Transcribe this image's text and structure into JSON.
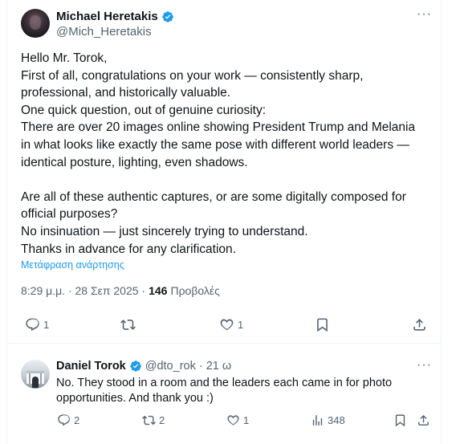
{
  "post": {
    "author_name": "Michael Heretakis",
    "handle": "@Mich_Heretakis",
    "lines": [
      "Hello Mr. Torok,",
      "First of all, congratulations on your work — consistently sharp,",
      "professional, and historically valuable.",
      "One quick question, out of genuine curiosity:",
      "There are over 20 images online showing President Trump and Melania",
      "in what looks like exactly the same pose with different world leaders —",
      "identical posture, lighting, even shadows.",
      "",
      "Are all of these authentic captures, or are some digitally composed for",
      "official purposes?",
      "No insinuation — just sincerely trying to understand.",
      "Thanks in advance for any clarification."
    ],
    "translate_label": "Μετάφραση ανάρτησης",
    "timestamp": "8:29 μ.μ. · 28 Σεπ 2025 ·",
    "views_count": "146",
    "views_label": "Προβολές",
    "replies": "1",
    "reposts": "",
    "likes": "1",
    "more": "···"
  },
  "reply": {
    "author_name": "Daniel Torok",
    "handle": "@dto_rok",
    "time": "21 ω",
    "lines": [
      "No. They stood in a room and the leaders each came in for photo",
      "opportunities. And thank you :)"
    ],
    "replies": "2",
    "reposts": "2",
    "likes": "1",
    "views": "348",
    "more": "···"
  },
  "colors": {
    "text": "#0f1419",
    "secondary": "#536471",
    "accent": "#1d9bf0",
    "border": "#eff3f4"
  },
  "icons": {
    "verified": "verified-badge-icon",
    "reply": "reply-icon",
    "repost": "repost-icon",
    "like": "heart-icon",
    "bookmark": "bookmark-icon",
    "share": "share-icon",
    "views": "views-icon",
    "more": "more-icon"
  }
}
